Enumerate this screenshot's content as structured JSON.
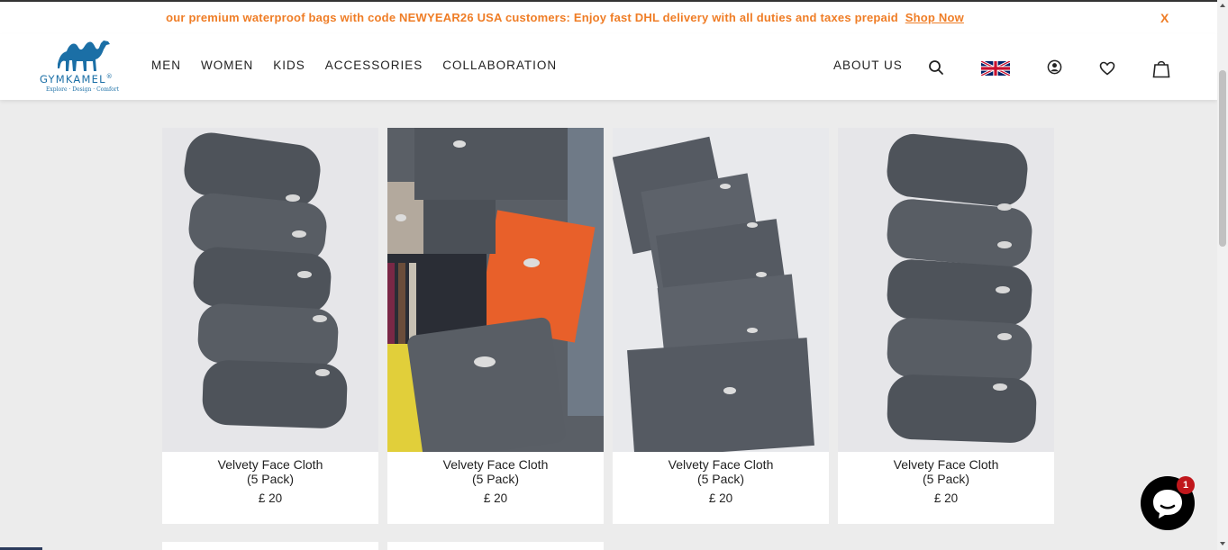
{
  "announcement": {
    "text": "our premium waterproof bags with code NEWYEAR26 USA customers: Enjoy fast DHL delivery with all duties and taxes prepaid",
    "link": "Shop Now",
    "close": "X"
  },
  "brand": {
    "name": "GYMKAMEL",
    "reg": "®",
    "tagline": "Explore · Design · Comfort",
    "color": "#1b6fa6"
  },
  "nav": {
    "items": [
      {
        "label": "MEN"
      },
      {
        "label": "WOMEN"
      },
      {
        "label": "KIDS"
      },
      {
        "label": "ACCESSORIES"
      },
      {
        "label": "COLLABORATION"
      }
    ],
    "about": "ABOUT US"
  },
  "header_icons": [
    "search-icon",
    "uk-flag-icon",
    "account-icon",
    "wishlist-heart-icon",
    "cart-bag-icon"
  ],
  "products": [
    {
      "title": "Velvety Face Cloth\n(5 Pack)",
      "price": "£ 20",
      "image": "rolled-grey-towels"
    },
    {
      "title": "Velvety Face Cloth\n(5 Pack)",
      "price": "£ 20",
      "image": "assorted-colour-towels"
    },
    {
      "title": "Velvety Face Cloth\n(5 Pack)",
      "price": "£ 20",
      "image": "fanned-grey-towels"
    },
    {
      "title": "Velvety Face Cloth\n(5 Pack)",
      "price": "£ 20",
      "image": "rolled-grey-towels"
    }
  ],
  "chat": {
    "badge": "1"
  },
  "colors": {
    "accent": "#ef7d26",
    "towel": "#545960",
    "background": "#ececec"
  }
}
